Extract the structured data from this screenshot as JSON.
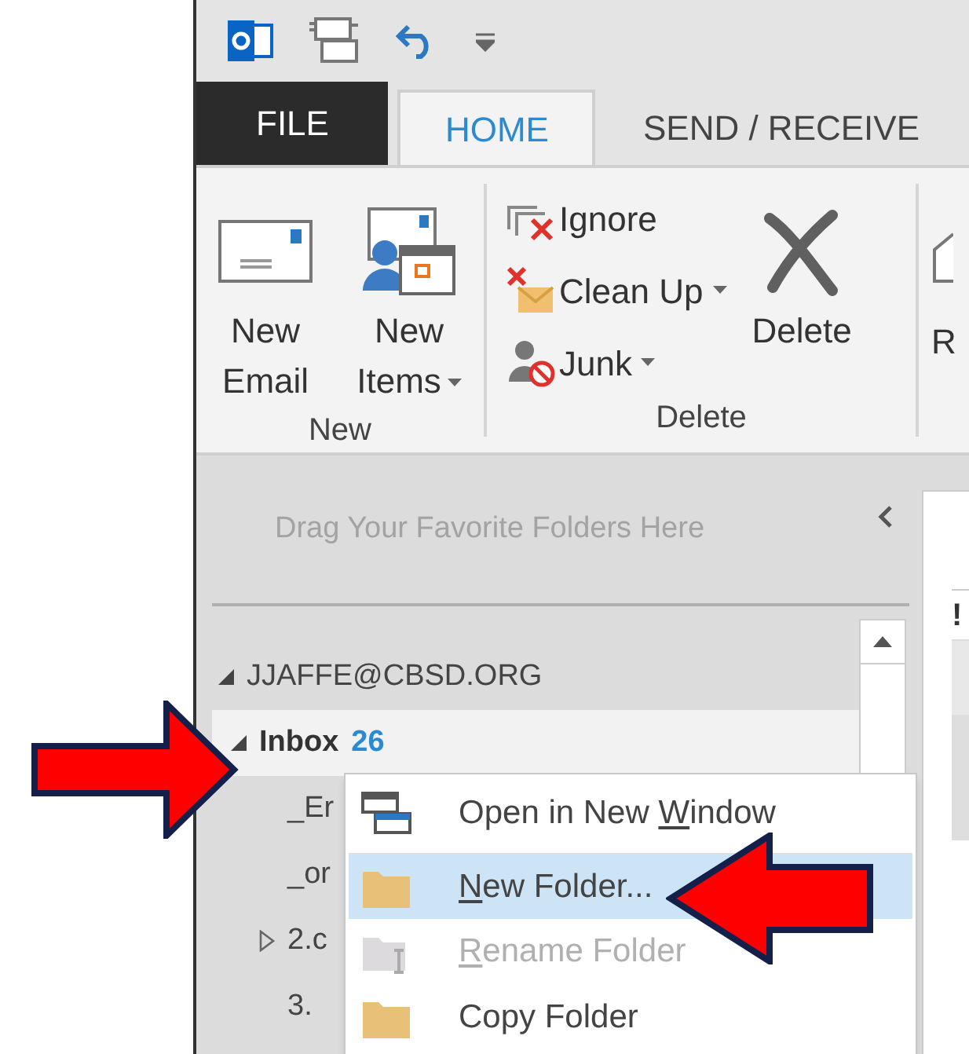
{
  "tabs": [
    {
      "label": "FILE",
      "kind": "file",
      "selected": false
    },
    {
      "label": "HOME",
      "kind": "tab",
      "selected": true
    },
    {
      "label": "SEND / RECEIVE",
      "kind": "tab",
      "selected": false
    }
  ],
  "ribbon": {
    "groups": [
      {
        "label": "New",
        "buttons": [
          {
            "kind": "large",
            "lines": [
              "New",
              "Email"
            ],
            "dropdown": false
          },
          {
            "kind": "large",
            "lines": [
              "New",
              "Items"
            ],
            "dropdown": true
          }
        ]
      },
      {
        "label": "Delete",
        "buttons": [
          {
            "kind": "small",
            "lines": [
              "Ignore"
            ],
            "dropdown": false
          },
          {
            "kind": "small",
            "lines": [
              "Clean Up"
            ],
            "dropdown": true
          },
          {
            "kind": "small",
            "lines": [
              "Junk"
            ],
            "dropdown": true
          },
          {
            "kind": "large",
            "lines": [
              "Delete"
            ],
            "dropdown": false
          }
        ]
      }
    ],
    "cut_button": "R"
  },
  "navigation": {
    "favorites_hint": "Drag Your Favorite Folders Here",
    "folders": [
      {
        "name": "JJAFFE@CBSD.ORG",
        "expanded": true,
        "selected": false,
        "children": [
          {
            "name": "Inbox",
            "count": "26",
            "expanded": true,
            "selected": true,
            "children": [
              {
                "name": "_Er",
                "selected": false
              },
              {
                "name": "_or",
                "selected": false
              },
              {
                "name": "2.c",
                "expanded": false,
                "selected": false
              },
              {
                "name": "3.",
                "selected": false
              }
            ]
          }
        ]
      }
    ]
  },
  "message_list": {
    "column_1": "!"
  },
  "context_menu": [
    {
      "before": "Open in New ",
      "key": "W",
      "after": "indow",
      "selected": false,
      "disabled": false
    },
    {
      "key": "N",
      "after": "ew Folder...",
      "selected": true,
      "disabled": false
    },
    {
      "key": "R",
      "after": "ename Folder",
      "selected": false,
      "disabled": true
    },
    {
      "before": "Copy Folder",
      "selected": false,
      "disabled": false
    }
  ]
}
